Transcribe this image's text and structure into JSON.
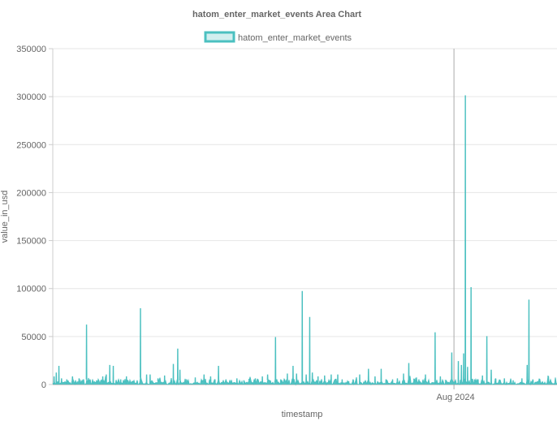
{
  "chart_data": {
    "type": "area",
    "title": "hatom_enter_market_events Area Chart",
    "xlabel": "timestamp",
    "ylabel": "value_in_usd",
    "legend": {
      "position": "top",
      "entries": [
        "hatom_enter_market_events"
      ]
    },
    "grid": true,
    "ylim": [
      0,
      350000
    ],
    "yticks": [
      0,
      50000,
      100000,
      150000,
      200000,
      250000,
      300000,
      350000
    ],
    "xticks": [
      {
        "label": "Aug 2024",
        "frac": 0.915
      }
    ],
    "colors": {
      "line": "#4bc0c0",
      "fill": "rgba(75,192,192,0.25)",
      "grid": "#e6e6e6",
      "axis": "#999999"
    },
    "series": [
      {
        "name": "hatom_enter_market_events",
        "spikes": [
          [
            0.003,
            8000
          ],
          [
            0.008,
            12000
          ],
          [
            0.014,
            19000
          ],
          [
            0.02,
            6000
          ],
          [
            0.032,
            5000
          ],
          [
            0.045,
            8000
          ],
          [
            0.06,
            6000
          ],
          [
            0.077,
            62000
          ],
          [
            0.085,
            5000
          ],
          [
            0.1,
            4000
          ],
          [
            0.114,
            8000
          ],
          [
            0.122,
            10000
          ],
          [
            0.13,
            20000
          ],
          [
            0.138,
            19000
          ],
          [
            0.155,
            5000
          ],
          [
            0.168,
            8000
          ],
          [
            0.182,
            3000
          ],
          [
            0.2,
            79000
          ],
          [
            0.214,
            10000
          ],
          [
            0.222,
            10000
          ],
          [
            0.24,
            6000
          ],
          [
            0.255,
            9000
          ],
          [
            0.275,
            21000
          ],
          [
            0.285,
            37000
          ],
          [
            0.29,
            15000
          ],
          [
            0.305,
            5000
          ],
          [
            0.325,
            7000
          ],
          [
            0.345,
            10000
          ],
          [
            0.36,
            8000
          ],
          [
            0.37,
            5000
          ],
          [
            0.378,
            19000
          ],
          [
            0.395,
            5000
          ],
          [
            0.42,
            6000
          ],
          [
            0.436,
            4000
          ],
          [
            0.448,
            3000
          ],
          [
            0.462,
            6000
          ],
          [
            0.478,
            8000
          ],
          [
            0.49,
            10000
          ],
          [
            0.508,
            49000
          ],
          [
            0.52,
            5000
          ],
          [
            0.535,
            11000
          ],
          [
            0.548,
            19000
          ],
          [
            0.556,
            11000
          ],
          [
            0.569,
            97000
          ],
          [
            0.578,
            10000
          ],
          [
            0.586,
            70000
          ],
          [
            0.592,
            12000
          ],
          [
            0.605,
            8000
          ],
          [
            0.62,
            9000
          ],
          [
            0.635,
            10000
          ],
          [
            0.65,
            10000
          ],
          [
            0.66,
            5000
          ],
          [
            0.675,
            3000
          ],
          [
            0.685,
            5000
          ],
          [
            0.7,
            10000
          ],
          [
            0.72,
            16000
          ],
          [
            0.735,
            8000
          ],
          [
            0.749,
            16000
          ],
          [
            0.76,
            5000
          ],
          [
            0.775,
            5000
          ],
          [
            0.786,
            6000
          ],
          [
            0.8,
            11000
          ],
          [
            0.812,
            22000
          ],
          [
            0.824,
            4000
          ],
          [
            0.835,
            5000
          ],
          [
            0.85,
            10000
          ],
          [
            0.872,
            54000
          ],
          [
            0.884,
            8000
          ],
          [
            0.896,
            4000
          ],
          [
            0.91,
            33000
          ],
          [
            0.925,
            24000
          ],
          [
            0.932,
            20000
          ],
          [
            0.937,
            32000
          ],
          [
            0.941,
            301000
          ],
          [
            0.946,
            18000
          ],
          [
            0.954,
            101000
          ],
          [
            0.962,
            5000
          ],
          [
            0.97,
            5000
          ],
          [
            0.98,
            9000
          ],
          [
            0.99,
            50000
          ],
          [
            1.0,
            15000
          ],
          [
            1.01,
            6000
          ],
          [
            1.03,
            6000
          ],
          [
            1.05,
            4000
          ],
          [
            1.07,
            6000
          ],
          [
            1.082,
            20000
          ],
          [
            1.086,
            88000
          ],
          [
            1.095,
            5000
          ],
          [
            1.11,
            3000
          ],
          [
            1.13,
            3000
          ]
        ]
      }
    ]
  }
}
